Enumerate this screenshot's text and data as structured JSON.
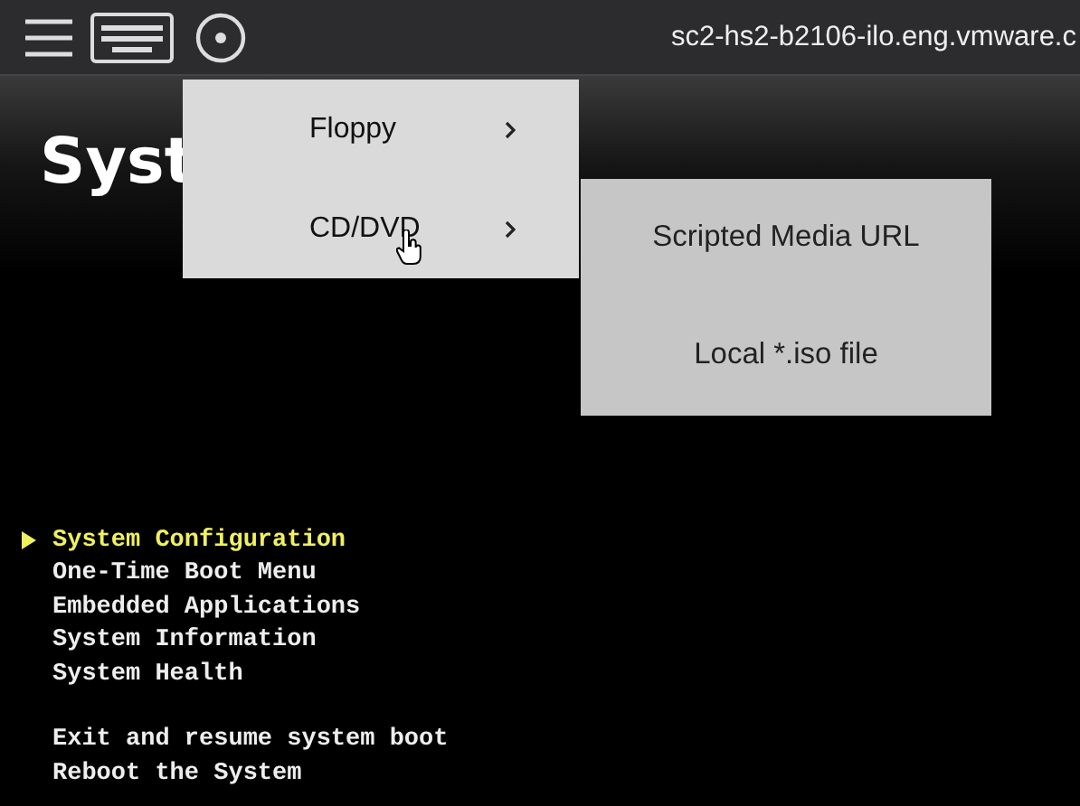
{
  "toolbar": {
    "host": "sc2-hs2-b2106-ilo.eng.vmware.c"
  },
  "screen": {
    "heading": "Syst",
    "sections": [
      {
        "items": [
          {
            "label": "System Configuration",
            "selected": true
          },
          {
            "label": "One-Time Boot Menu",
            "selected": false
          },
          {
            "label": "Embedded Applications",
            "selected": false
          },
          {
            "label": "System Information",
            "selected": false
          },
          {
            "label": "System Health",
            "selected": false
          }
        ]
      },
      {
        "items": [
          {
            "label": "Exit and resume system boot",
            "selected": false
          },
          {
            "label": "Reboot the System",
            "selected": false
          }
        ]
      }
    ]
  },
  "media_menu": {
    "items": [
      {
        "label": "Floppy"
      },
      {
        "label": "CD/DVD"
      }
    ]
  },
  "submenu": {
    "items": [
      {
        "label": "Scripted Media URL"
      },
      {
        "label": "Local *.iso file"
      }
    ]
  }
}
